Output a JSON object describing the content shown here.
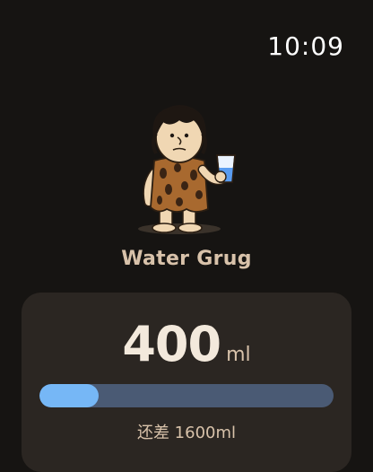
{
  "status_bar": {
    "time": "10:09"
  },
  "app": {
    "name": "Water Grug"
  },
  "intake": {
    "amount": "400",
    "unit": "ml",
    "progress": 0.2,
    "remaining_text": "还差 1600ml"
  },
  "colors": {
    "background": "#161412",
    "card": "#2b2622",
    "accent": "#76b7f6",
    "track": "#4a5a74",
    "label": "#d8c2aa"
  },
  "icons": {
    "mascot": "caveman-holding-water-glass"
  }
}
